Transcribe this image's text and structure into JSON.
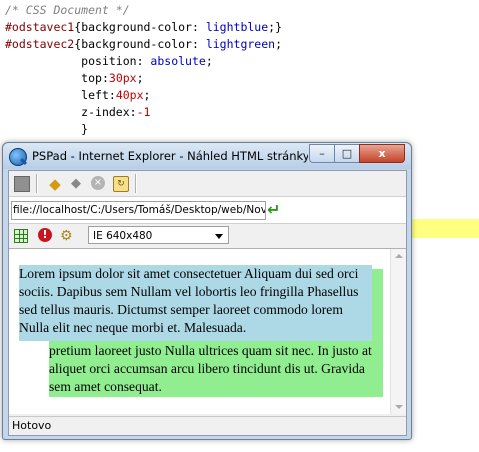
{
  "editor": {
    "lines": [
      {
        "parts": [
          {
            "cls": "cmt",
            "text": "/* CSS Document */"
          }
        ]
      },
      {
        "parts": [
          {
            "cls": "sel",
            "text": "#odstavec1"
          },
          {
            "cls": "blk",
            "text": "{"
          },
          {
            "cls": "prop",
            "text": "background-color"
          },
          {
            "cls": "blk",
            "text": ": "
          },
          {
            "cls": "val",
            "text": "lightblue"
          },
          {
            "cls": "blk",
            "text": ";}"
          }
        ]
      },
      {
        "parts": [
          {
            "cls": "sel",
            "text": "#odstavec2"
          },
          {
            "cls": "blk",
            "text": "{"
          },
          {
            "cls": "prop",
            "text": "background-color"
          },
          {
            "cls": "blk",
            "text": ": "
          },
          {
            "cls": "val",
            "text": "lightgreen"
          },
          {
            "cls": "blk",
            "text": ";"
          }
        ]
      },
      {
        "parts": [
          {
            "cls": "blk",
            "text": "           "
          },
          {
            "cls": "prop",
            "text": "position"
          },
          {
            "cls": "blk",
            "text": ": "
          },
          {
            "cls": "val",
            "text": "absolute"
          },
          {
            "cls": "blk",
            "text": ";"
          }
        ]
      },
      {
        "parts": [
          {
            "cls": "blk",
            "text": "           "
          },
          {
            "cls": "prop",
            "text": "top"
          },
          {
            "cls": "blk",
            "text": ":"
          },
          {
            "cls": "num",
            "text": "30px"
          },
          {
            "cls": "blk",
            "text": ";"
          }
        ]
      },
      {
        "parts": [
          {
            "cls": "blk",
            "text": "           "
          },
          {
            "cls": "prop",
            "text": "left"
          },
          {
            "cls": "blk",
            "text": ":"
          },
          {
            "cls": "num",
            "text": "40px"
          },
          {
            "cls": "blk",
            "text": ";"
          }
        ]
      },
      {
        "parts": [
          {
            "cls": "blk",
            "text": "           "
          },
          {
            "cls": "prop",
            "text": "z-index"
          },
          {
            "cls": "blk",
            "text": ":"
          },
          {
            "cls": "num",
            "text": "-1"
          }
        ]
      },
      {
        "parts": [
          {
            "cls": "blk",
            "text": "           }"
          }
        ]
      }
    ]
  },
  "window": {
    "title": "PSPad - Internet Explorer - Náhled HTML stránky",
    "buttons": {
      "minimize": "–",
      "maximize": "□",
      "close": "x"
    },
    "address": "file://localhost/C:/Users/Tomáš/Desktop/web/Nov",
    "browser_mode": "IE 640x480",
    "status": "Hotovo",
    "paragraph1": "Lorem ipsum dolor sit amet consectetuer Aliquam dui sed orci sociis. Dapibus sem Nullam vel lobortis leo fringilla Phasellus sed tellus mauris. Dictumst semper laoreet commodo lorem Nulla elit nec neque morbi et. Malesuada.",
    "paragraph2": "pretium laoreet justo Nulla ultrices quam sit nec. In justo at aliquet orci accumsan arcu libero tincidunt dis ut. Gravida sem amet consequat."
  }
}
